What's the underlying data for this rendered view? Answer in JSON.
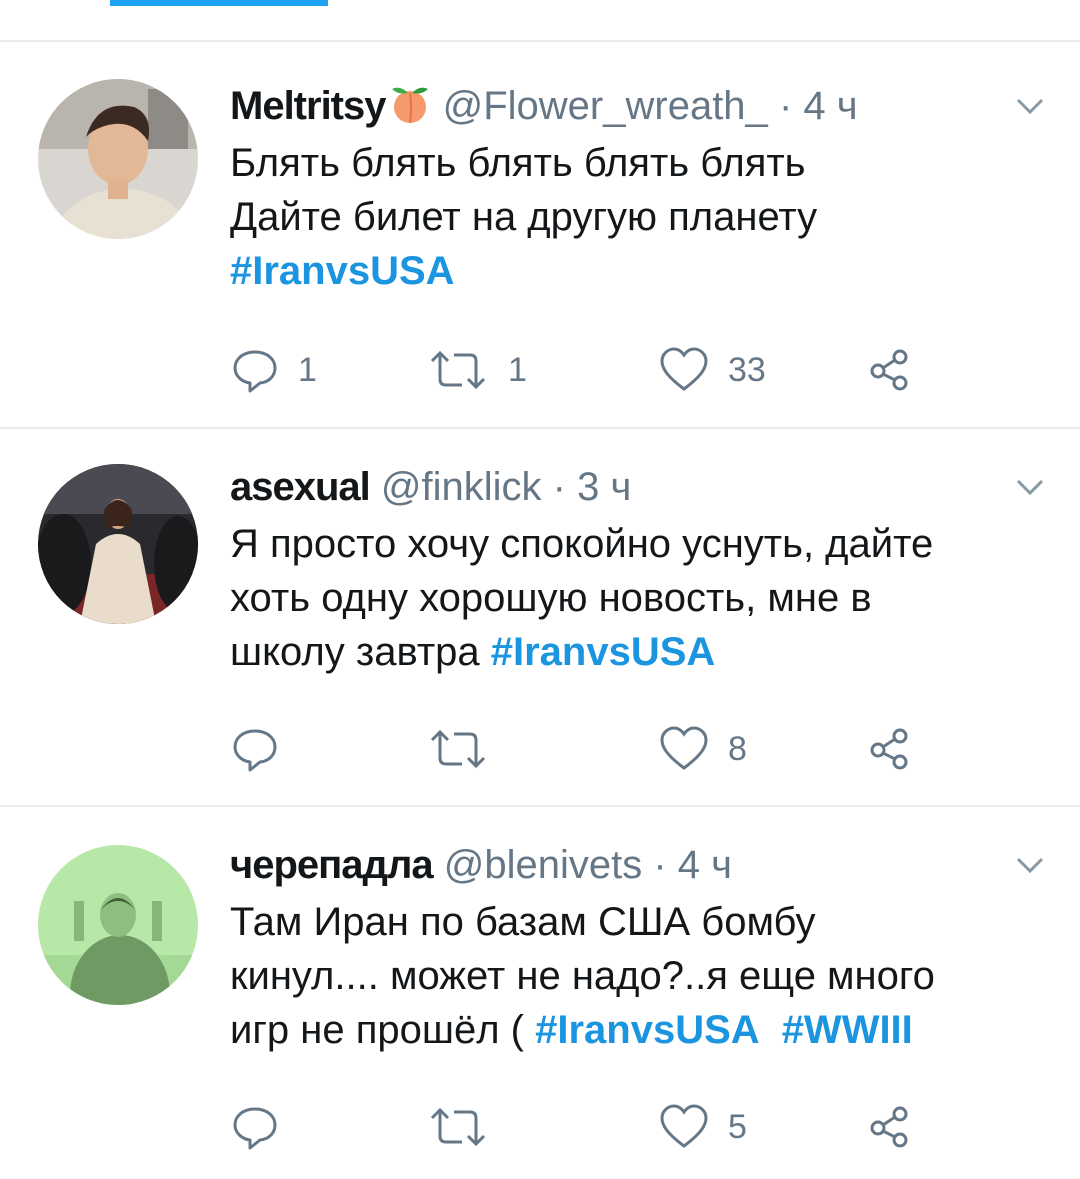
{
  "colors": {
    "accent": "#1da1f2",
    "hashtag": "#1b95e0",
    "muted": "#657786",
    "text": "#14171a"
  },
  "tweets": [
    {
      "name": "Meltritsy",
      "name_emoji": "peach-icon",
      "handle": "@Flower_wreath_",
      "separator": "·",
      "time": "4 ч",
      "lines": [
        "Блять блять блять блять блять",
        "Дайте билет на другую планету"
      ],
      "hashtags": [
        "#IranvsUSA"
      ],
      "reply_count": "1",
      "retweet_count": "1",
      "like_count": "33"
    },
    {
      "name": "asexual",
      "handle": "@finklick",
      "separator": "·",
      "time": "3 ч",
      "lines": [
        "Я просто хочу спокойно уснуть, дайте",
        "хоть одну хорошую новость, мне в",
        "школу завтра "
      ],
      "hashtags": [
        "#IranvsUSA"
      ],
      "reply_count": "",
      "retweet_count": "",
      "like_count": "8"
    },
    {
      "name": "черепадла",
      "handle": "@blenivets",
      "separator": "·",
      "time": "4 ч",
      "lines": [
        "Там Иран по базам США бомбу",
        "кинул.... может не надо?..я еще много",
        "игр не прошёл ( "
      ],
      "hashtags": [
        "#IranvsUSA",
        "#WWIII"
      ],
      "reply_count": "",
      "retweet_count": "",
      "like_count": "5"
    }
  ]
}
